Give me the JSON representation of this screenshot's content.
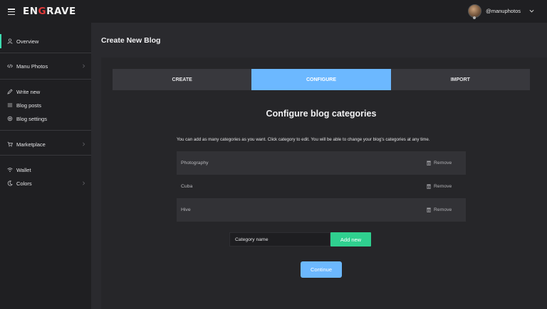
{
  "header": {
    "logo_left": "EN",
    "logo_mid": "G",
    "logo_right": "RAVE",
    "username": "@manuphotos"
  },
  "sidebar": {
    "items": [
      {
        "label": "Overview",
        "icon": "user-icon"
      },
      {
        "label": "Manu Photos",
        "icon": "code-icon"
      },
      {
        "label": "Write new",
        "icon": "pencil-icon"
      },
      {
        "label": "Blog posts",
        "icon": "list-icon"
      },
      {
        "label": "Blog settings",
        "icon": "gear-icon"
      },
      {
        "label": "Marketplace",
        "icon": "cart-icon"
      },
      {
        "label": "Wallet",
        "icon": "wifi-icon"
      },
      {
        "label": "Colors",
        "icon": "moon-icon"
      }
    ]
  },
  "page": {
    "title": "Create New Blog"
  },
  "tabs": [
    {
      "label": "CREATE",
      "active": false
    },
    {
      "label": "CONFIGURE",
      "active": true
    },
    {
      "label": "IMPORT",
      "active": false
    }
  ],
  "configure": {
    "title": "Configure blog categories",
    "description": "You can add as many categories as you want. Click category to edit. You will be able to change your blog's categories at any time.",
    "categories": [
      {
        "name": "Photography",
        "remove_label": "Remove"
      },
      {
        "name": "Cuba",
        "remove_label": "Remove"
      },
      {
        "name": "Hive",
        "remove_label": "Remove"
      }
    ],
    "input_placeholder": "Category name",
    "add_label": "Add new",
    "continue_label": "Continue"
  },
  "colors": {
    "accent_blue": "#6cb8ff",
    "accent_green": "#2fd08f",
    "active_marker": "#3ddcb0",
    "logo_red": "#e23a3a"
  }
}
